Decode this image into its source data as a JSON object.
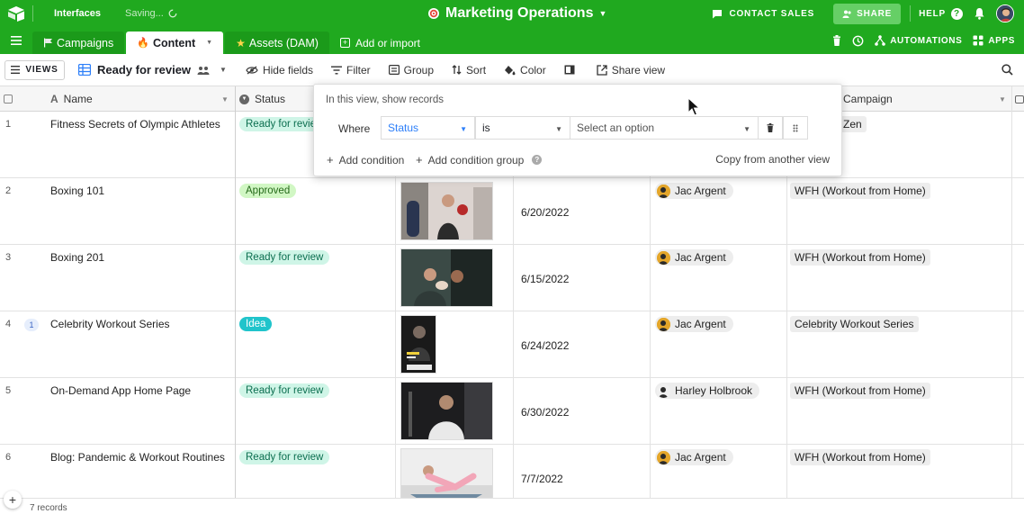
{
  "topbar": {
    "interfaces_label": "Interfaces",
    "saving_label": "Saving...",
    "base_title": "Marketing Operations",
    "contact_sales_label": "CONTACT SALES",
    "share_label": "SHARE",
    "help_label": "HELP"
  },
  "tabs": {
    "items": [
      {
        "label": "Campaigns",
        "icon": "flag-icon"
      },
      {
        "label": "Content",
        "icon": "fire-icon"
      },
      {
        "label": "Assets (DAM)",
        "icon": "star-icon"
      }
    ],
    "add_label": "Add or import",
    "automations_label": "AUTOMATIONS",
    "apps_label": "APPS"
  },
  "toolbar": {
    "views_label": "VIEWS",
    "view_name": "Ready for review",
    "hide_fields": "Hide fields",
    "filter": "Filter",
    "group": "Group",
    "sort": "Sort",
    "color": "Color",
    "share_view": "Share view"
  },
  "columns": {
    "name": "Name",
    "status": "Status",
    "campaign": "Campaign"
  },
  "rows": [
    {
      "num": "1",
      "name": "Fitness Secrets of Olympic Athletes",
      "status": "Ready for review",
      "date": "",
      "owner": "",
      "campaign": "Zen"
    },
    {
      "num": "2",
      "name": "Boxing 101",
      "status": "Approved",
      "date": "6/20/2022",
      "owner": "Jac Argent",
      "campaign": "WFH (Workout from Home)"
    },
    {
      "num": "3",
      "name": "Boxing 201",
      "status": "Ready for review",
      "date": "6/15/2022",
      "owner": "Jac Argent",
      "campaign": "WFH (Workout from Home)"
    },
    {
      "num": "4",
      "badge": "1",
      "name": "Celebrity Workout Series",
      "status": "Idea",
      "date": "6/24/2022",
      "owner": "Jac Argent",
      "campaign": "Celebrity Workout Series"
    },
    {
      "num": "5",
      "name": "On-Demand App Home Page",
      "status": "Ready for review",
      "date": "6/30/2022",
      "owner": "Harley Holbrook",
      "campaign": "WFH (Workout from Home)"
    },
    {
      "num": "6",
      "name": "Blog: Pandemic & Workout Routines",
      "status": "Ready for review",
      "date": "7/7/2022",
      "owner": "Jac Argent",
      "campaign": "WFH (Workout from Home)"
    }
  ],
  "footer": {
    "record_count": "7 records"
  },
  "filter_popover": {
    "title": "In this view, show records",
    "where_label": "Where",
    "field_value": "Status",
    "operator_value": "is",
    "value_placeholder": "Select an option",
    "add_condition": "Add condition",
    "add_condition_group": "Add condition group",
    "copy_from_view": "Copy from another view"
  },
  "colors": {
    "brand_green": "#20a91f",
    "status_review_bg": "#cff5e7",
    "status_approved_bg": "#d1f7c4",
    "status_idea_bg": "#20c4cb",
    "link_blue": "#2d7ff9"
  }
}
